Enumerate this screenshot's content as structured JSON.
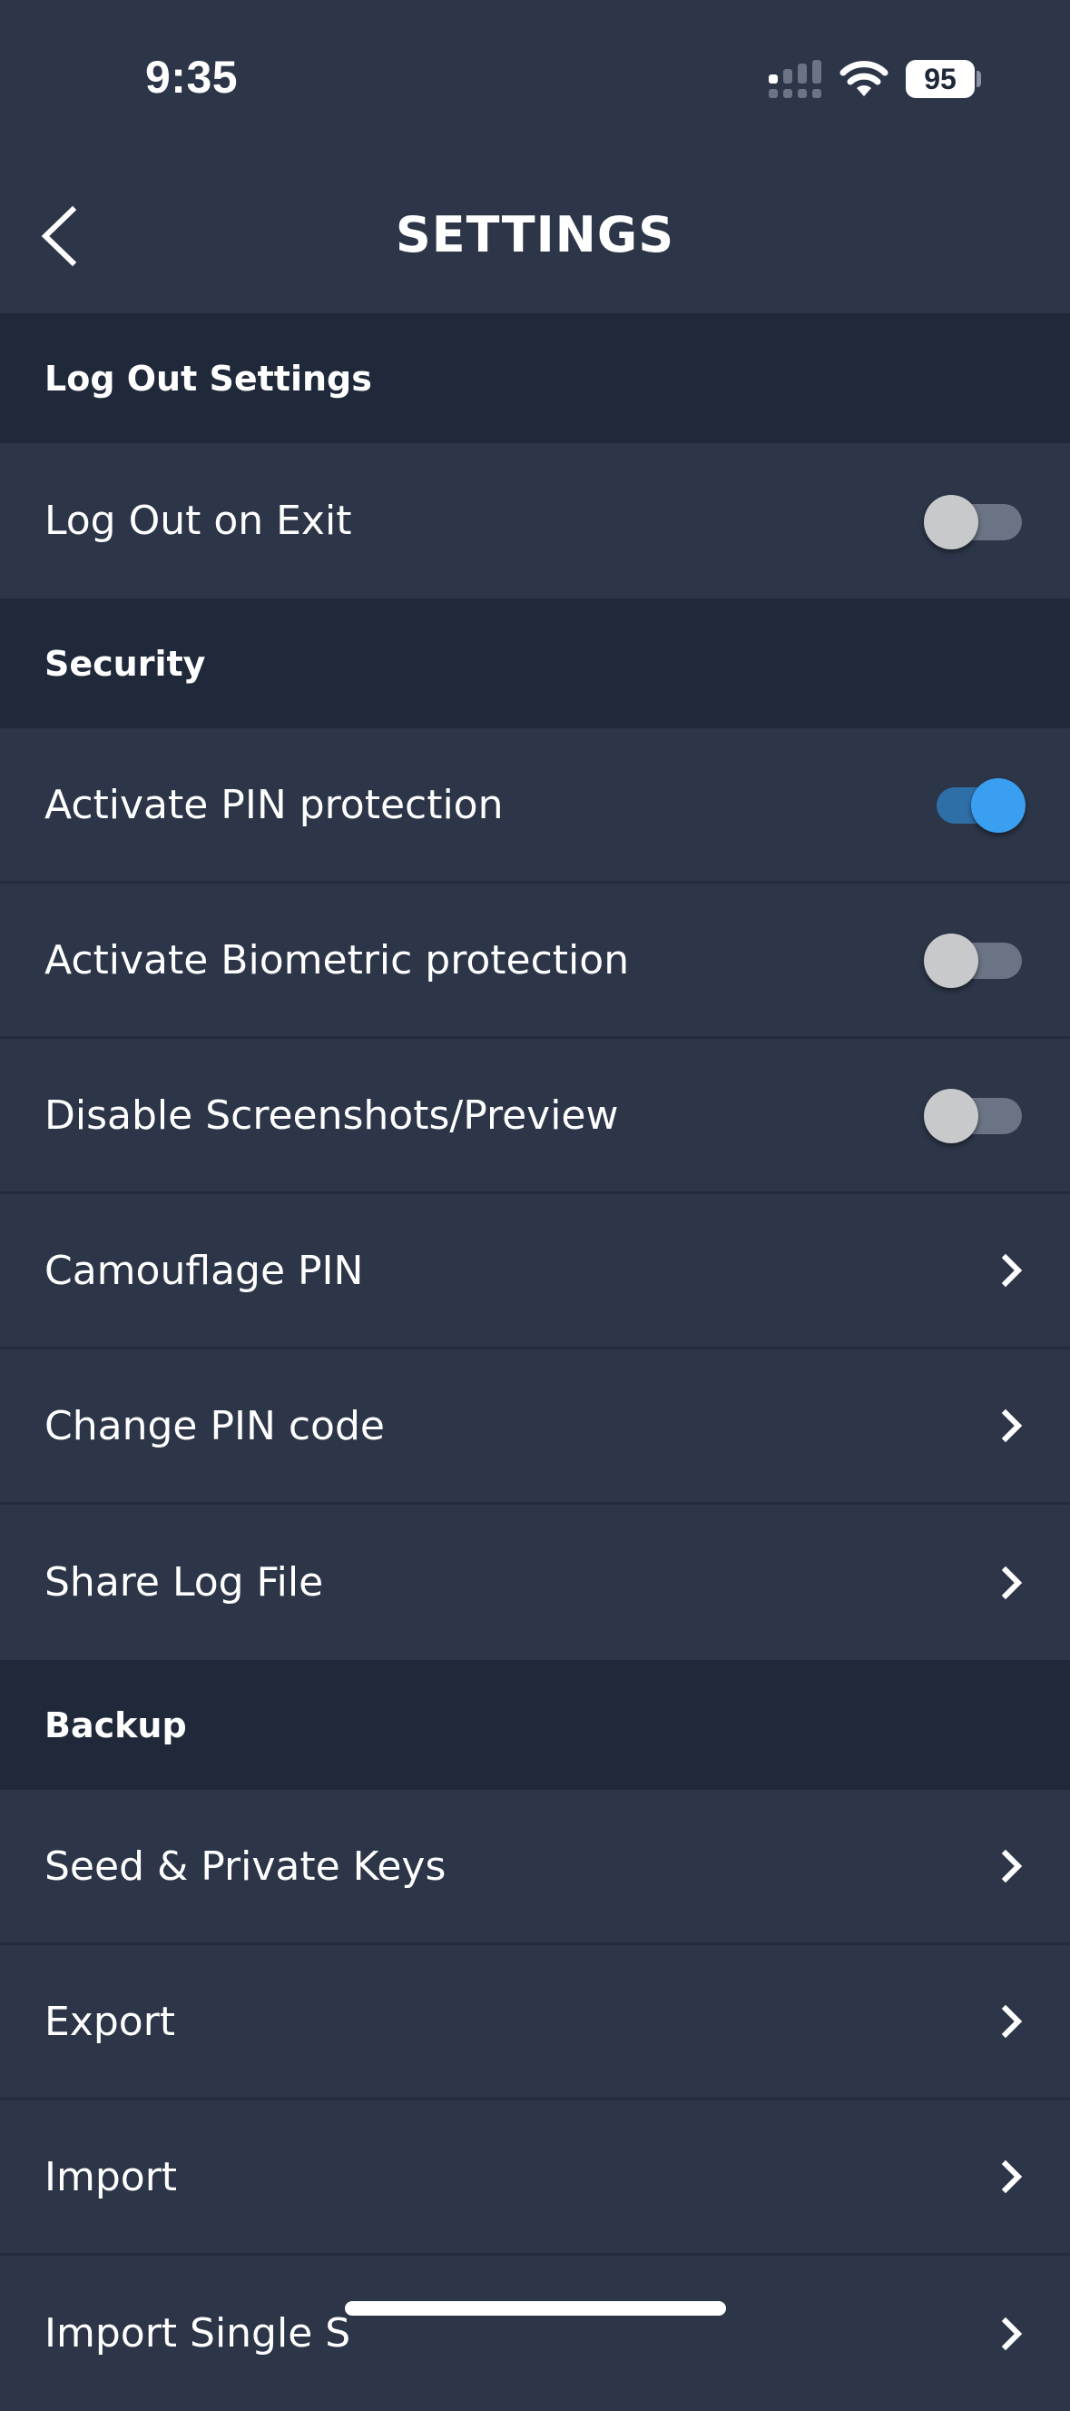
{
  "status_bar": {
    "time": "9:35",
    "battery_level": "95",
    "signal_icon": "cellular-signal-icon",
    "wifi_icon": "wifi-icon"
  },
  "header": {
    "title": "SETTINGS",
    "back_icon": "chevron-left-icon"
  },
  "sections": [
    {
      "title": "Log Out Settings",
      "items": [
        {
          "label": "Log Out on Exit",
          "type": "toggle",
          "value": false
        }
      ]
    },
    {
      "title": "Security",
      "items": [
        {
          "label": "Activate PIN protection",
          "type": "toggle",
          "value": true
        },
        {
          "label": "Activate Biometric protection",
          "type": "toggle",
          "value": false
        },
        {
          "label": "Disable Screenshots/Preview",
          "type": "toggle",
          "value": false
        },
        {
          "label": "Camouflage PIN",
          "type": "link",
          "icon": "chevron-right-icon"
        },
        {
          "label": "Change PIN code",
          "type": "link",
          "icon": "chevron-right-icon"
        },
        {
          "label": "Share Log File",
          "type": "link",
          "icon": "chevron-right-icon"
        }
      ]
    },
    {
      "title": "Backup",
      "items": [
        {
          "label": "Seed & Private Keys",
          "type": "link",
          "icon": "chevron-right-icon"
        },
        {
          "label": "Export",
          "type": "link",
          "icon": "chevron-right-icon"
        },
        {
          "label": "Import",
          "type": "link",
          "icon": "chevron-right-icon"
        },
        {
          "label": "Import Single S",
          "type": "link",
          "icon": "chevron-right-icon"
        }
      ]
    }
  ],
  "colors": {
    "background": "#2c3648",
    "section_header_bg": "#1f2939",
    "divider": "#222c3c",
    "toggle_on_knob": "#3a9ff0",
    "toggle_on_track": "#2f6fa8",
    "toggle_off_knob": "#c8c9cb",
    "toggle_off_track": "#6b7484"
  }
}
